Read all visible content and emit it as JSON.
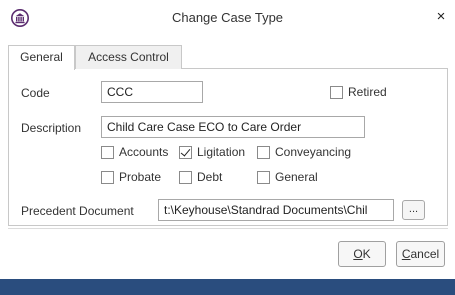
{
  "window": {
    "title": "Change Case Type",
    "close_glyph": "×"
  },
  "tabs": [
    {
      "label": "General",
      "active": true
    },
    {
      "label": "Access Control",
      "active": false
    }
  ],
  "form": {
    "code_label": "Code",
    "code_value": "CCC",
    "retired_label": "Retired",
    "retired_checked": false,
    "description_label": "Description",
    "description_value": "Child Care Case ECO to Care Order",
    "checkboxes": [
      {
        "label": "Accounts",
        "checked": false
      },
      {
        "label": "Ligitation",
        "checked": true
      },
      {
        "label": "Conveyancing",
        "checked": false
      },
      {
        "label": "Probate",
        "checked": false
      },
      {
        "label": "Debt",
        "checked": false
      },
      {
        "label": "General",
        "checked": false
      }
    ],
    "precedent_label": "Precedent Document",
    "precedent_value": "t:\\Keyhouse\\Standrad Documents\\Chil",
    "browse_label": "..."
  },
  "buttons": {
    "ok_label": "OK",
    "ok_mnemonic": "O",
    "ok_rest": "K",
    "cancel_mnemonic": "C",
    "cancel_rest": "ancel"
  },
  "colors": {
    "logo": "#5b2c6f",
    "footer": "#2a4d7e"
  },
  "icons": {
    "logo": "bank-columns-icon",
    "close": "close-icon"
  }
}
